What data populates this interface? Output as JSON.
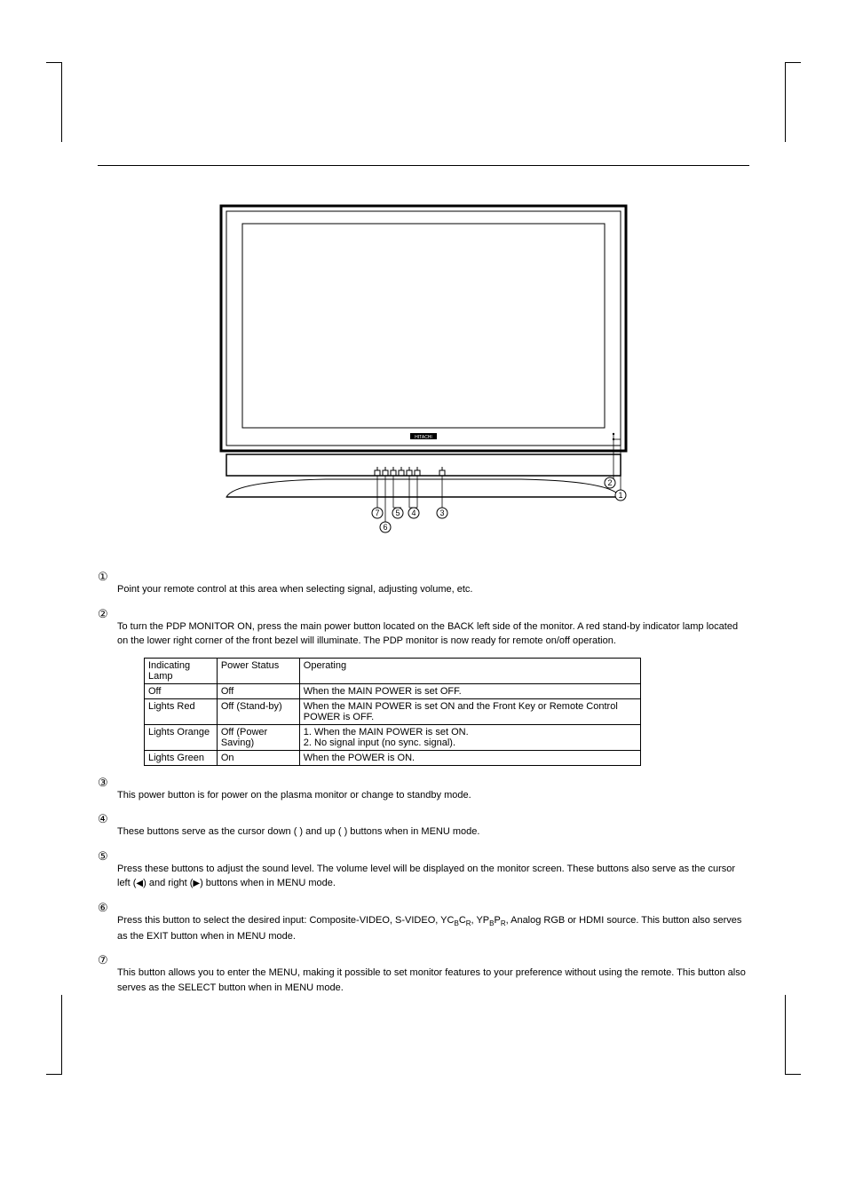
{
  "diagram": {
    "brand": "HITACHI",
    "callouts": [
      "1",
      "2",
      "3",
      "4",
      "5",
      "6",
      "7"
    ]
  },
  "items": [
    {
      "num": "①",
      "body": "Point your remote control at this area when selecting signal, adjusting volume, etc."
    },
    {
      "num": "②",
      "body": "To turn the PDP MONITOR ON, press the main power button located on the BACK left side of the monitor. A red stand-by indicator lamp located on the lower right corner of the front bezel will illuminate. The PDP monitor is now ready for remote on/off operation."
    },
    {
      "num": "③",
      "body": "This power button is for power on the plasma monitor or change to standby mode."
    },
    {
      "num": "④",
      "body": "These buttons serve as the cursor down (   ) and up (   ) buttons when in MENU mode."
    },
    {
      "num": "⑤",
      "body_html": "Press these buttons to adjust the sound level. The volume level will be displayed on the monitor screen. These buttons also serve as the cursor left (<span class='tri'>◀</span>) and right (<span class='tri'>▶</span>) buttons when in MENU mode."
    },
    {
      "num": "⑥",
      "body_html": "Press this button to select the desired input: Composite-VIDEO, S-VIDEO, YC<sub>B</sub>C<sub>R</sub>, YP<sub>B</sub>P<sub>R</sub>, Analog RGB or HDMI source. This button also serves as the EXIT button when in MENU mode."
    },
    {
      "num": "⑦",
      "body": "This button allows you to enter the MENU, making it possible to set monitor features to your preference without using the remote. This button also serves as the SELECT button when in MENU mode."
    }
  ],
  "table": {
    "header": [
      "Indicating Lamp",
      "Power Status",
      "Operating"
    ],
    "rows": [
      [
        "Off",
        "Off",
        "When the MAIN POWER is set OFF."
      ],
      [
        "Lights Red",
        "Off (Stand-by)",
        "When the MAIN POWER is set ON and the Front Key or Remote Control POWER is OFF."
      ],
      [
        "Lights Orange",
        "Off (Power Saving)",
        "1. When the MAIN POWER is set ON.\n2. No signal input (no sync. signal)."
      ],
      [
        "Lights Green",
        "On",
        "When the POWER is ON."
      ]
    ]
  }
}
